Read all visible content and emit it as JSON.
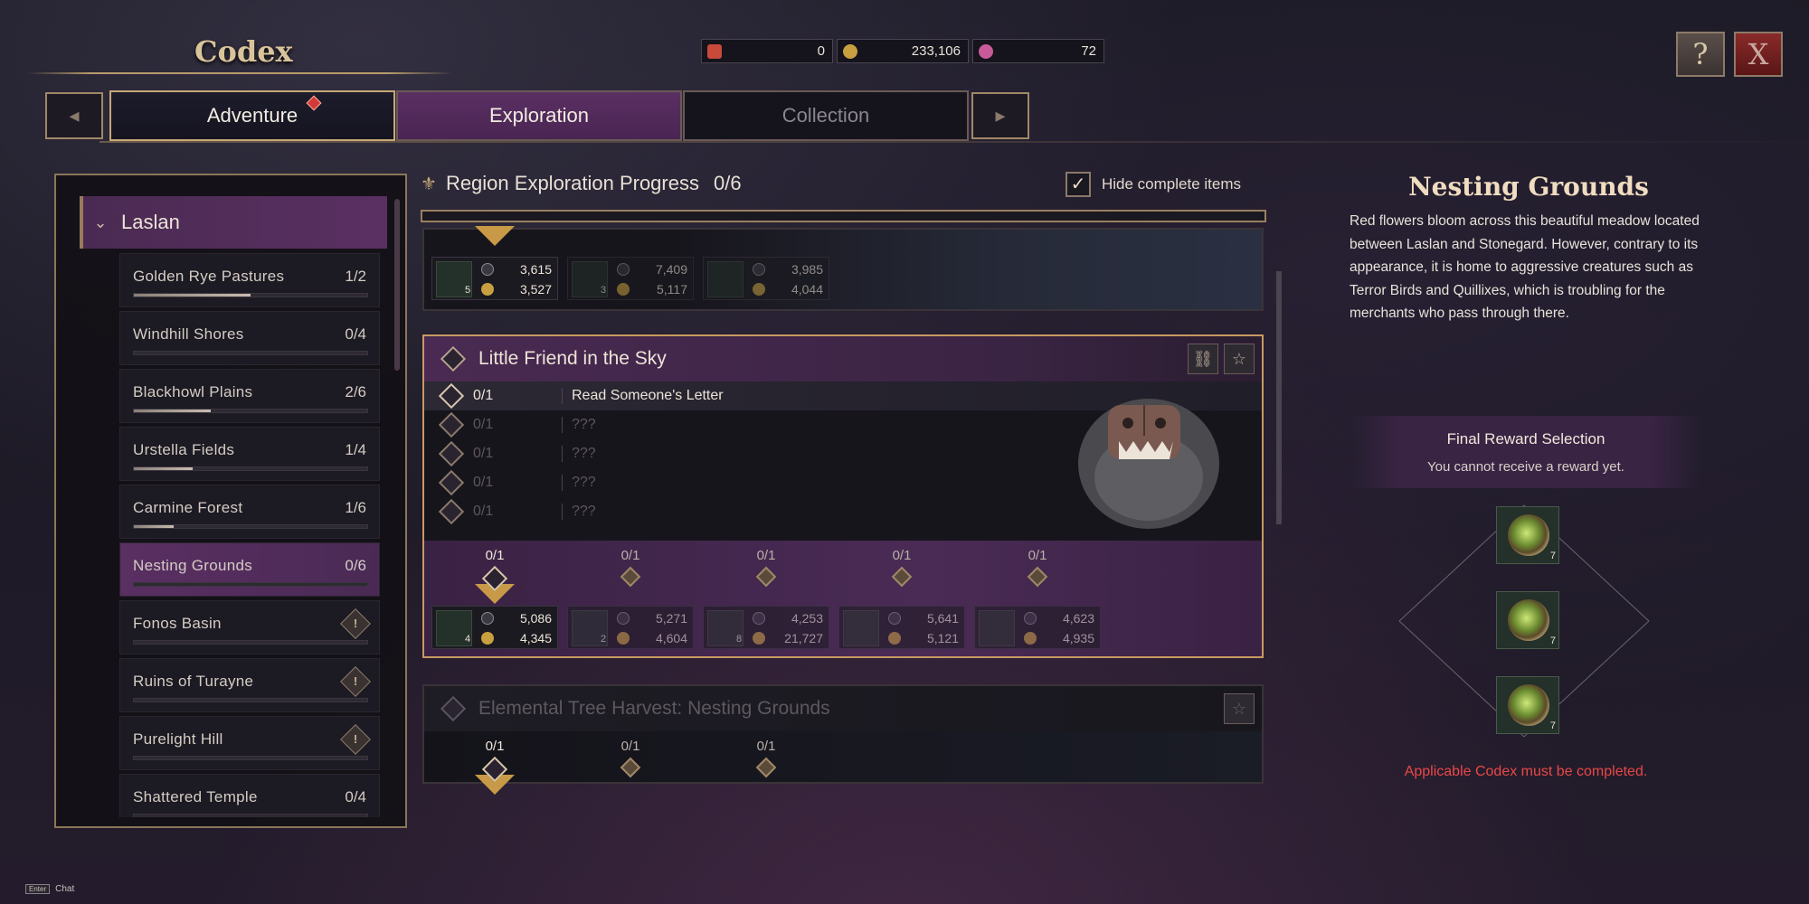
{
  "header": {
    "title": "Codex",
    "currencies": [
      {
        "icon": "ticket-icon",
        "value": "0"
      },
      {
        "icon": "gold-coin-icon",
        "value": "233,106"
      },
      {
        "icon": "gem-icon",
        "value": "72"
      }
    ],
    "help_label": "?",
    "close_label": "X"
  },
  "tabs": [
    {
      "label": "Adventure",
      "badge": true
    },
    {
      "label": "Exploration"
    },
    {
      "label": "Collection"
    }
  ],
  "region": {
    "name": "Laslan",
    "zones": [
      {
        "name": "Golden Rye Pastures",
        "count": "1/2",
        "progress": 0.5
      },
      {
        "name": "Windhill Shores",
        "count": "0/4",
        "progress": 0
      },
      {
        "name": "Blackhowl Plains",
        "count": "2/6",
        "progress": 0.33
      },
      {
        "name": "Urstella Fields",
        "count": "1/4",
        "progress": 0.25
      },
      {
        "name": "Carmine Forest",
        "count": "1/6",
        "progress": 0.17
      },
      {
        "name": "Nesting Grounds",
        "count": "0/6",
        "progress": 0,
        "selected": true
      },
      {
        "name": "Fonos Basin",
        "count": "",
        "locked": true,
        "progress": 0
      },
      {
        "name": "Ruins of Turayne",
        "count": "",
        "locked": true,
        "progress": 0
      },
      {
        "name": "Purelight Hill",
        "count": "",
        "locked": true,
        "progress": 0
      },
      {
        "name": "Shattered Temple",
        "count": "0/4",
        "progress": 0
      }
    ]
  },
  "center": {
    "title": "Region Exploration Progress",
    "count": "0/6",
    "hide_label": "Hide complete items",
    "hide_checked": "✓",
    "top_rewards": [
      {
        "qty": "5",
        "exp": "3,615",
        "gold": "3,527"
      },
      {
        "qty": "3",
        "exp": "7,409",
        "gold": "5,117"
      },
      {
        "qty": "",
        "exp": "3,985",
        "gold": "4,044"
      }
    ],
    "card": {
      "title": "Little Friend in the Sky",
      "tasks": [
        {
          "progress": "0/1",
          "name": "Read Someone's Letter"
        },
        {
          "progress": "0/1",
          "name": "???"
        },
        {
          "progress": "0/1",
          "name": "???"
        },
        {
          "progress": "0/1",
          "name": "???"
        },
        {
          "progress": "0/1",
          "name": "???"
        }
      ],
      "milestones": [
        "0/1",
        "0/1",
        "0/1",
        "0/1",
        "0/1"
      ],
      "rewards": [
        {
          "qty": "4",
          "exp": "5,086",
          "gold": "4,345"
        },
        {
          "qty": "2",
          "exp": "5,271",
          "gold": "4,604"
        },
        {
          "qty": "8",
          "exp": "4,253",
          "gold": "21,727"
        },
        {
          "qty": "",
          "exp": "5,641",
          "gold": "5,121"
        },
        {
          "qty": "",
          "exp": "4,623",
          "gold": "4,935"
        }
      ]
    },
    "next_card": {
      "title": "Elemental Tree Harvest: Nesting Grounds",
      "milestones": [
        "0/1",
        "0/1",
        "0/1"
      ]
    }
  },
  "detail": {
    "title": "Nesting Grounds",
    "description": "Red flowers bloom across this beautiful meadow located between Laslan and Stonegard. However, contrary to its appearance, it is home to aggressive creatures such as Terror Birds and Quillixes, which is troubling for the merchants who pass through there.",
    "final_title": "Final Reward Selection",
    "final_sub": "You cannot receive a reward yet.",
    "reward_qty": [
      "7",
      "7",
      "7"
    ],
    "warning": "Applicable Codex must be completed."
  },
  "footer": {
    "key": "Enter",
    "label": "Chat"
  },
  "colors": {
    "accent_purple": "#4a2a52",
    "gold": "#c89a60",
    "warning": "#e84848"
  }
}
